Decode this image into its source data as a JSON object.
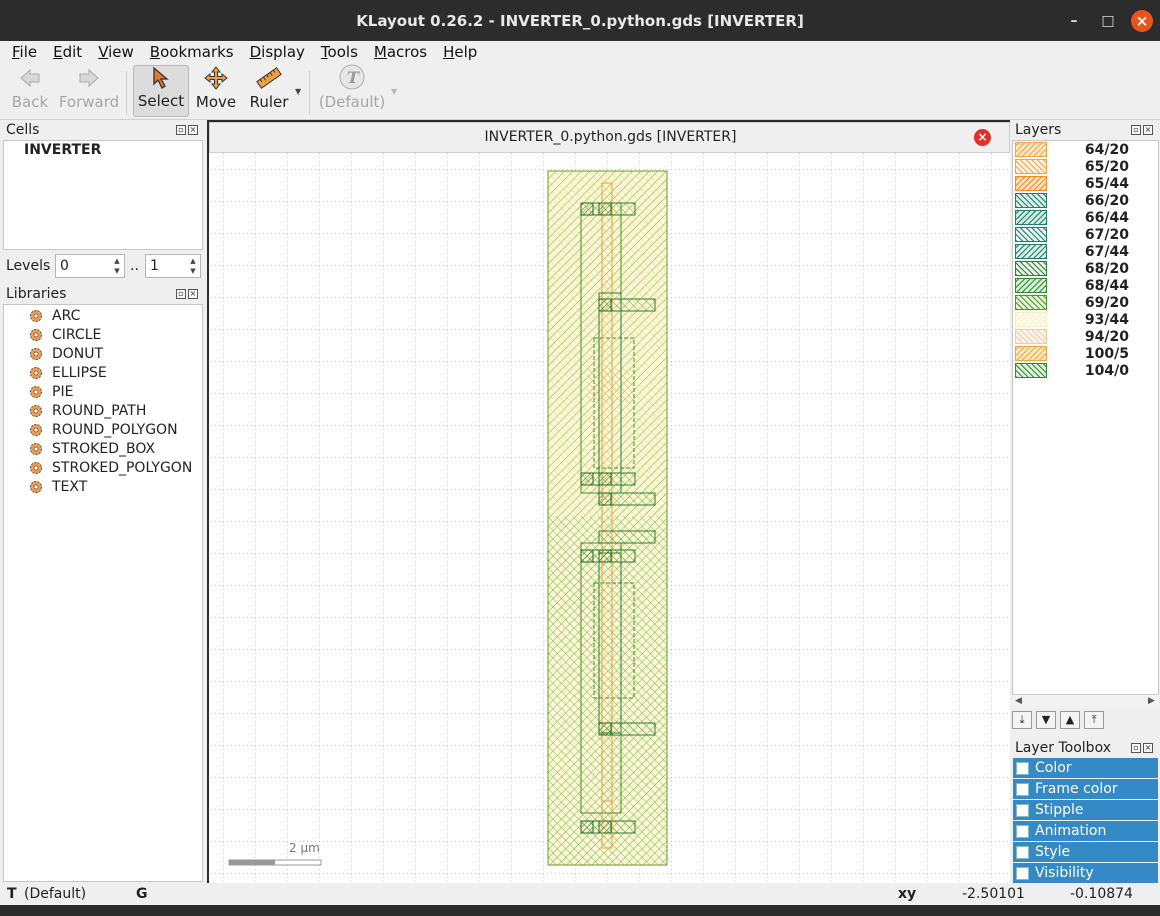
{
  "window": {
    "title": "KLayout 0.26.2 - INVERTER_0.python.gds [INVERTER]",
    "minimize": "–",
    "maximize": "□",
    "close": "×"
  },
  "menu": [
    {
      "key": "F",
      "rest": "ile"
    },
    {
      "key": "E",
      "rest": "dit"
    },
    {
      "key": "V",
      "rest": "iew"
    },
    {
      "key": "B",
      "rest": "ookmarks"
    },
    {
      "key": "D",
      "rest": "isplay"
    },
    {
      "key": "T",
      "rest": "ools"
    },
    {
      "key": "M",
      "rest": "acros"
    },
    {
      "key": "H",
      "rest": "elp"
    }
  ],
  "toolbar": {
    "back": "Back",
    "forward": "Forward",
    "select": "Select",
    "move": "Move",
    "ruler": "Ruler",
    "default": "(Default)"
  },
  "cells": {
    "title": "Cells",
    "items": [
      "INVERTER"
    ]
  },
  "levels": {
    "label": "Levels",
    "from": "0",
    "separator": "..",
    "to": "1"
  },
  "libraries": {
    "title": "Libraries",
    "items": [
      "ARC",
      "CIRCLE",
      "DONUT",
      "ELLIPSE",
      "PIE",
      "ROUND_PATH",
      "ROUND_POLYGON",
      "STROKED_BOX",
      "STROKED_POLYGON",
      "TEXT"
    ]
  },
  "view": {
    "tab_title": "INVERTER_0.python.gds [INVERTER]",
    "scale_label": "2  µm"
  },
  "layers": {
    "title": "Layers",
    "items": [
      {
        "name": "64/20",
        "color": "#f5a342",
        "fill": "#fde8c4"
      },
      {
        "name": "65/20",
        "color": "#f5a342",
        "fill": "#fff3e0"
      },
      {
        "name": "65/44",
        "color": "#f08a20",
        "fill": "#fde0bb"
      },
      {
        "name": "66/20",
        "color": "#1e7d6b",
        "fill": "#d9eeea"
      },
      {
        "name": "66/44",
        "color": "#1e7d6b",
        "fill": "#cfe9e3"
      },
      {
        "name": "67/20",
        "color": "#1e7d6b",
        "fill": "#e6f3f0"
      },
      {
        "name": "67/44",
        "color": "#1e7d6b",
        "fill": "#d7ece7"
      },
      {
        "name": "68/20",
        "color": "#2e7d32",
        "fill": "#e6f2e6"
      },
      {
        "name": "68/44",
        "color": "#2e8b2e",
        "fill": "#d6edd6"
      },
      {
        "name": "69/20",
        "color": "#4a9a20",
        "fill": "#e5f2d8"
      },
      {
        "name": "93/44",
        "color": "#f4f0c8",
        "fill": "#fdfbe8"
      },
      {
        "name": "94/20",
        "color": "#f2c9a0",
        "fill": "#fff4ea"
      },
      {
        "name": "100/5",
        "color": "#f5a342",
        "fill": "#fde8c4"
      },
      {
        "name": "104/0",
        "color": "#2e8b2e",
        "fill": "#dff0df"
      }
    ]
  },
  "layer_toolbox": {
    "title": "Layer Toolbox",
    "items": [
      "Color",
      "Frame color",
      "Stipple",
      "Animation",
      "Style",
      "Visibility"
    ]
  },
  "status": {
    "mode_icon": "T",
    "mode": "(Default)",
    "grid_icon": "G",
    "xy_label": "xy",
    "x": "-2.50101",
    "y": "-0.10874"
  }
}
